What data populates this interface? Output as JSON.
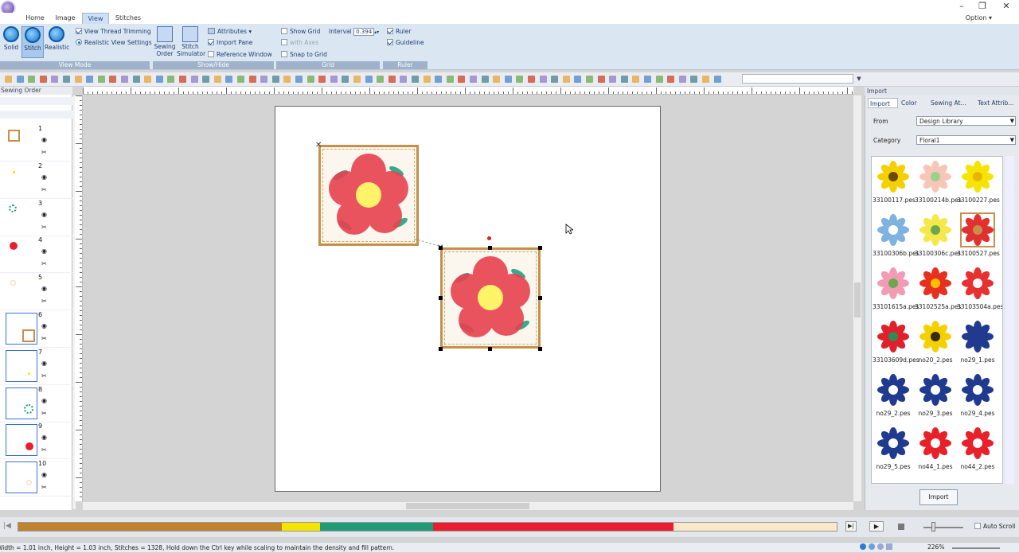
{
  "window": {
    "minimize": "–",
    "restore": "❐",
    "close": "✕"
  },
  "tabs": [
    {
      "label": "Home"
    },
    {
      "label": "Image"
    },
    {
      "label": "View"
    },
    {
      "label": "Stitches"
    }
  ],
  "option_label": "Option",
  "ribbon": {
    "view_mode": {
      "label": "View Mode",
      "buttons": [
        {
          "label": "Solid"
        },
        {
          "label": "Stitch"
        },
        {
          "label": "Realistic"
        }
      ],
      "view_thread_trimming": "View Thread Trimming",
      "realistic_view_settings": "Realistic View Settings"
    },
    "show_hide": {
      "label": "Show/Hide",
      "sewing_order": [
        "Sewing",
        "Order"
      ],
      "stitch_simulator": [
        "Stitch",
        "Simulator"
      ],
      "attributes": "Attributes",
      "import_pane": "Import Pane",
      "reference_window": "Reference Window"
    },
    "grid": {
      "label": "Grid",
      "show_grid": "Show Grid",
      "interval_label": "Interval",
      "interval_value": "0.394",
      "with_axes": "with Axes",
      "snap_to_grid": "Snap to Grid"
    },
    "ruler": {
      "label": "Ruler",
      "ruler": "Ruler",
      "guideline": "Guideline"
    }
  },
  "sewing_order": {
    "title": "Sewing Order",
    "items": [
      {
        "num": "1"
      },
      {
        "num": "2"
      },
      {
        "num": "3"
      },
      {
        "num": "4"
      },
      {
        "num": "5"
      },
      {
        "num": "6"
      },
      {
        "num": "7"
      },
      {
        "num": "8"
      },
      {
        "num": "9"
      },
      {
        "num": "10"
      }
    ],
    "eye": "👁",
    "cut": "✂"
  },
  "import_panel": {
    "title": "Import",
    "tabs": [
      {
        "label": "Import"
      },
      {
        "label": "Color"
      },
      {
        "label": "Sewing At..."
      },
      {
        "label": "Text Attrib..."
      }
    ],
    "from_label": "From",
    "from_value": "Design Library",
    "category_label": "Category",
    "category_value": "Floral1",
    "files": [
      "33100117.pes",
      "33100214b.pes",
      "33100227.pes",
      "33100306b.pes",
      "33100306c.pes",
      "33100527.pes",
      "33101615a.pes",
      "33102525a.pes",
      "33103504a.pes",
      "33103609d.pes",
      "no20_2.pes",
      "no29_1.pes",
      "no29_2.pes",
      "no29_3.pes",
      "no29_4.pes",
      "no29_5.pes",
      "no44_1.pes",
      "no44_2.pes"
    ],
    "import_button": "Import"
  },
  "colorbar": {
    "colors": [
      "#c0822c",
      "#f5e400",
      "#1f9b78",
      "#e81e2e",
      "#fbe7c9"
    ],
    "weights": [
      332,
      48,
      142,
      303,
      205
    ]
  },
  "playback": {
    "auto_scroll": "Auto Scroll"
  },
  "status": {
    "text": "Width = 1.01 inch, Height = 1.03 inch, Stitches = 1328, Hold down the Ctrl key while scaling to maintain the density and fill pattern.",
    "zoom": "226%"
  }
}
